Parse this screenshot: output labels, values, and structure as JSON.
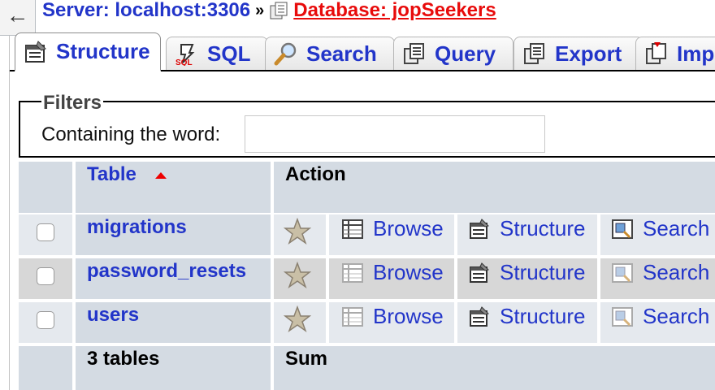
{
  "breadcrumb": {
    "back_glyph": "←",
    "server": "Server: localhost:3306",
    "separator": "»",
    "database": "Database: jopSeekers"
  },
  "tabs": [
    {
      "label": "Structure",
      "icon": "structure-icon",
      "active": true
    },
    {
      "label": "SQL",
      "icon": "sql-icon",
      "active": false
    },
    {
      "label": "Search",
      "icon": "search-icon",
      "active": false
    },
    {
      "label": "Query",
      "icon": "query-icon",
      "active": false
    },
    {
      "label": "Export",
      "icon": "export-icon",
      "active": false
    },
    {
      "label": "Imp",
      "icon": "import-icon",
      "active": false
    }
  ],
  "filters": {
    "legend": "Filters",
    "label": "Containing the word:",
    "value": ""
  },
  "table": {
    "headers": {
      "table": "Table",
      "action": "Action"
    },
    "rows": [
      {
        "name": "migrations",
        "browse": "Browse",
        "structure": "Structure",
        "search": "Search"
      },
      {
        "name": "password_resets",
        "browse": "Browse",
        "structure": "Structure",
        "search": "Search"
      },
      {
        "name": "users",
        "browse": "Browse",
        "structure": "Structure",
        "search": "Search"
      }
    ],
    "footer": {
      "count": "3 tables",
      "sum": "Sum"
    }
  },
  "colors": {
    "link": "#2235c9",
    "database_crumb": "#e80b0b",
    "header_bg": "#d4dbe3",
    "row_bg": "#e5e9ee",
    "hover_row_bg": "#d7d7d7"
  }
}
